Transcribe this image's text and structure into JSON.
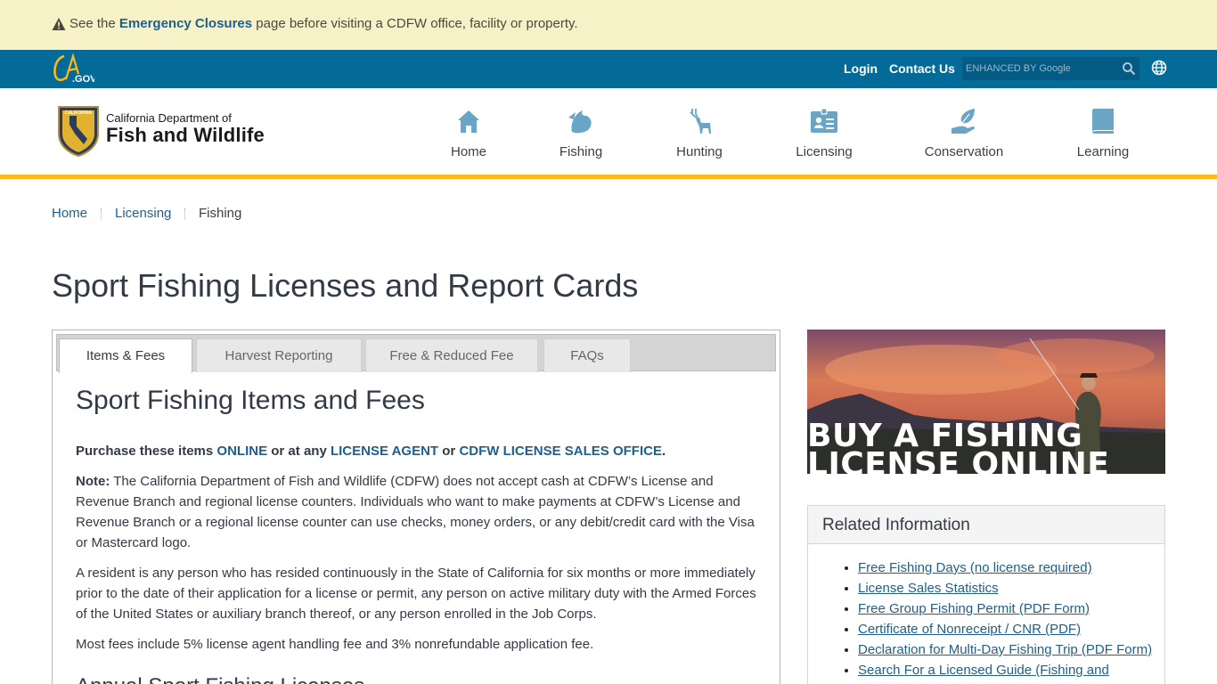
{
  "alert": {
    "prefix": "See the",
    "link": "Emergency Closures",
    "suffix": "page before visiting a CDFW office, facility or property."
  },
  "utility": {
    "logo_text": "CA.GOV",
    "login": "Login",
    "contact": "Contact Us",
    "search_placeholder": "ENHANCED BY Google"
  },
  "brand": {
    "subtitle": "California Department of",
    "title": "Fish and Wildlife"
  },
  "nav": [
    {
      "label": "Home",
      "icon": "home-icon"
    },
    {
      "label": "Fishing",
      "icon": "fish-icon"
    },
    {
      "label": "Hunting",
      "icon": "deer-icon"
    },
    {
      "label": "Licensing",
      "icon": "id-card-icon"
    },
    {
      "label": "Conservation",
      "icon": "hand-leaf-icon"
    },
    {
      "label": "Learning",
      "icon": "book-icon"
    }
  ],
  "breadcrumb": [
    "Home",
    "Licensing",
    "Fishing"
  ],
  "page_title": "Sport Fishing Licenses and Report Cards",
  "tabs": [
    "Items & Fees",
    "Harvest Reporting",
    "Free & Reduced Fee",
    "FAQs"
  ],
  "content": {
    "heading": "Sport Fishing Items and Fees",
    "purchase_prefix": "Purchase these items",
    "purchase_online": "ONLINE",
    "purchase_or1": "or at any",
    "purchase_agent": "LICENSE AGENT",
    "purchase_or2": "or",
    "purchase_office": "CDFW LICENSE SALES OFFICE",
    "purchase_end": ".",
    "note_label": "Note:",
    "note_text": "The California Department of Fish and Wildlife (CDFW) does not accept cash at CDFW’s License and Revenue Branch and regional license counters. Individuals who want to make payments at CDFW’s License and Revenue Branch or a regional license counter can use checks, money orders, or any debit/credit card with the Visa or Mastercard logo.",
    "resident_text": "A resident is any person who has resided continuously in the State of California for six months or more immediately prior to the date of their application for a license or permit, any person on active military duty with the Armed Forces of the United States or auxiliary branch thereof, or any person enrolled in the Job Corps.",
    "fees_text": "Most fees include 5% license agent handling fee and 3% nonrefundable application fee.",
    "subheading": "Annual Sport Fishing Licenses"
  },
  "promo": {
    "line1": "BUY A FISHING",
    "line2": "LICENSE ONLINE"
  },
  "related": {
    "title": "Related Information",
    "links": [
      "Free Fishing Days (no license required)",
      "License Sales Statistics",
      "Free Group Fishing Permit (PDF Form)",
      "Certificate of Nonreceipt / CNR (PDF)",
      "Declaration for Multi-Day Fishing Trip (PDF Form)",
      "Search For a Licensed Guide (Fishing and"
    ]
  },
  "colors": {
    "alert_bg": "#f7f1c8",
    "utility_bg": "#046b99",
    "accent_gold": "#fdb81e",
    "link_blue": "#1f5f8b",
    "nav_icon_blue": "#6aa5c6"
  }
}
